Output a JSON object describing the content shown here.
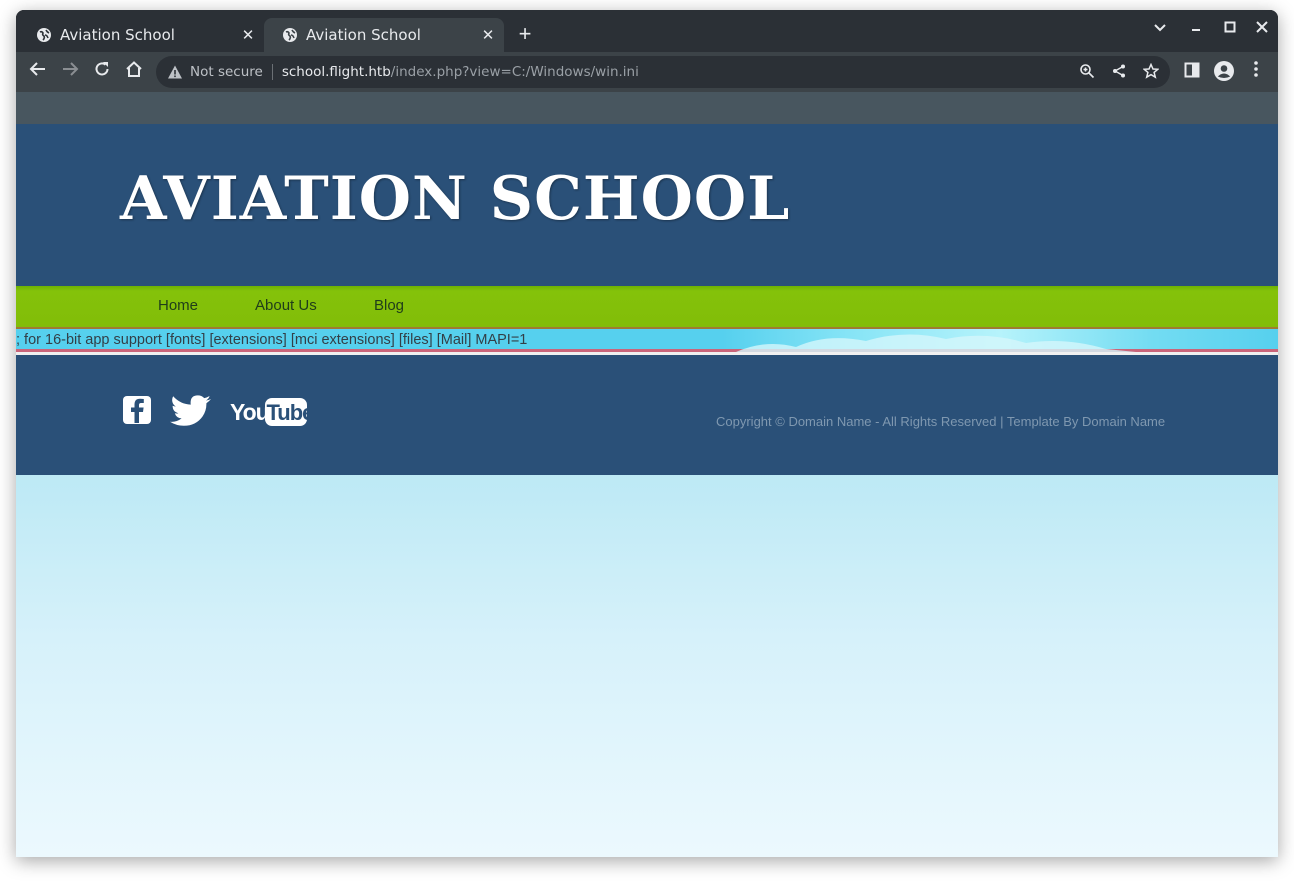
{
  "browser": {
    "tabs": [
      {
        "title": "Aviation School",
        "active": false
      },
      {
        "title": "Aviation School",
        "active": true
      }
    ],
    "new_tab_symbol": "+",
    "omnibox": {
      "security_label": "Not secure",
      "host": "school.flight.htb",
      "path": "/index.php?view=C:/Windows/win.ini"
    },
    "icons": {
      "back": "arrow-left-icon",
      "forward": "arrow-right-icon",
      "reload": "reload-icon",
      "home": "home-icon",
      "zoom": "zoom-icon",
      "share": "share-icon",
      "bookmark": "star-icon",
      "side_panel": "side-panel-icon",
      "profile": "profile-icon",
      "menu": "kebab-menu-icon"
    }
  },
  "site": {
    "logo_text": "AVIATION SCHOOL",
    "nav": [
      {
        "label": "Home"
      },
      {
        "label": "About Us"
      },
      {
        "label": "Blog"
      }
    ],
    "included_file_text": "; for 16-bit app support [fonts] [extensions] [mci extensions] [files] [Mail] MAPI=1",
    "social": [
      "facebook-icon",
      "twitter-icon",
      "youtube-icon"
    ],
    "youtube_text": {
      "you": "You",
      "tube": "Tube"
    },
    "copyright": "Copyright © Domain Name - All Rights Reserved | Template By Domain Name",
    "colors": {
      "header_bg": "#2a5078",
      "nav_bg": "#82bd08",
      "page_bg_top": "#79d6ea"
    }
  }
}
